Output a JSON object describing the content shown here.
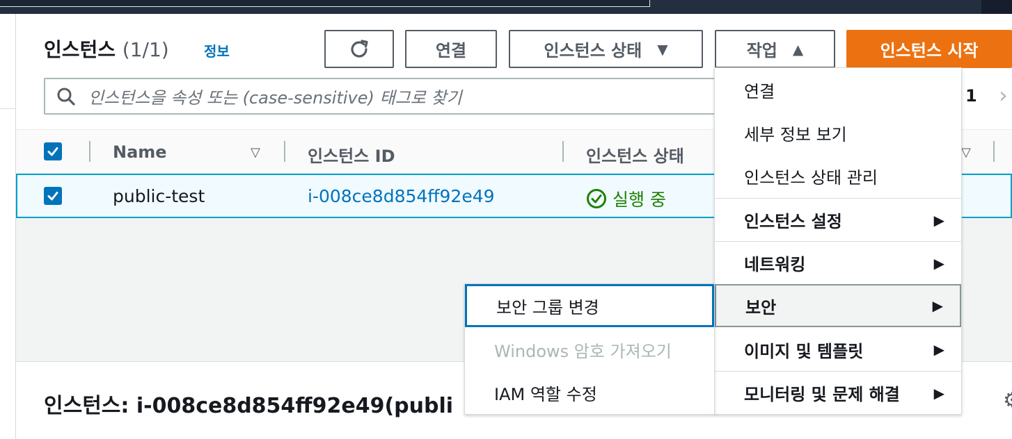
{
  "header": {
    "title": "인스턴스",
    "count": "(1/1)",
    "info_link": "정보"
  },
  "toolbar": {
    "refresh_icon": "refresh-icon",
    "connect_label": "연결",
    "instance_state_label": "인스턴스 상태",
    "actions_label": "작업",
    "launch_label": "인스턴스 시작"
  },
  "search": {
    "placeholder": "인스턴스을 속성 또는 (case-sensitive) 태그로 찾기"
  },
  "pagination": {
    "current_page": "1",
    "next_icon": "chevron-right-icon"
  },
  "table": {
    "columns": [
      "Name",
      "인스턴스 ID",
      "인스턴스 상태"
    ],
    "rows": [
      {
        "name": "public-test",
        "instance_id": "i-008ce8d854ff92e49",
        "state": "실행 중"
      }
    ]
  },
  "detail": {
    "title": "인스턴스: i-008ce8d854ff92e49(publi"
  },
  "actions_menu": {
    "items": [
      {
        "label": "연결"
      },
      {
        "label": "세부 정보 보기"
      },
      {
        "label": "인스턴스 상태 관리"
      },
      {
        "label": "인스턴스 설정"
      },
      {
        "label": "네트워킹"
      },
      {
        "label": "보안"
      },
      {
        "label": "이미지 및 템플릿"
      },
      {
        "label": "모니터링 및 문제 해결"
      }
    ]
  },
  "security_submenu": {
    "items": [
      {
        "label": "보안 그룹 변경"
      },
      {
        "label": "Windows 암호 가져오기"
      },
      {
        "label": "IAM 역할 수정"
      }
    ]
  },
  "colors": {
    "primary": "#ec7211",
    "link": "#0073bb",
    "success": "#1d8102",
    "selection_border": "#00a1c9"
  }
}
